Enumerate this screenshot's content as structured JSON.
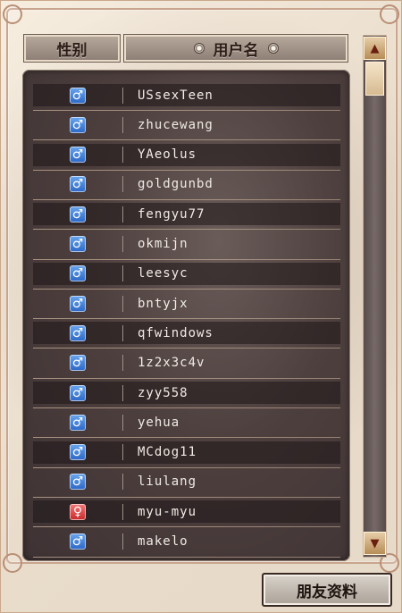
{
  "header": {
    "gender_label": "性别",
    "username_label": "用户名"
  },
  "users": [
    {
      "gender": "male",
      "name": "USsexTeen"
    },
    {
      "gender": "male",
      "name": "zhucewang"
    },
    {
      "gender": "male",
      "name": "YAeolus"
    },
    {
      "gender": "male",
      "name": "goldgunbd"
    },
    {
      "gender": "male",
      "name": "fengyu77"
    },
    {
      "gender": "male",
      "name": "okmijn"
    },
    {
      "gender": "male",
      "name": "leesyc"
    },
    {
      "gender": "male",
      "name": "bntyjx"
    },
    {
      "gender": "male",
      "name": "qfwindows"
    },
    {
      "gender": "male",
      "name": "1z2x3c4v"
    },
    {
      "gender": "male",
      "name": "zyy558"
    },
    {
      "gender": "male",
      "name": "yehua"
    },
    {
      "gender": "male",
      "name": "MCdog11"
    },
    {
      "gender": "male",
      "name": "liulang"
    },
    {
      "gender": "female",
      "name": "myu-myu"
    },
    {
      "gender": "male",
      "name": "makelo"
    }
  ],
  "icons": {
    "male": "♂",
    "female": "♀",
    "scroll_up": "▲",
    "scroll_down": "▼"
  },
  "footer": {
    "friend_info_label": "朋友资料"
  }
}
